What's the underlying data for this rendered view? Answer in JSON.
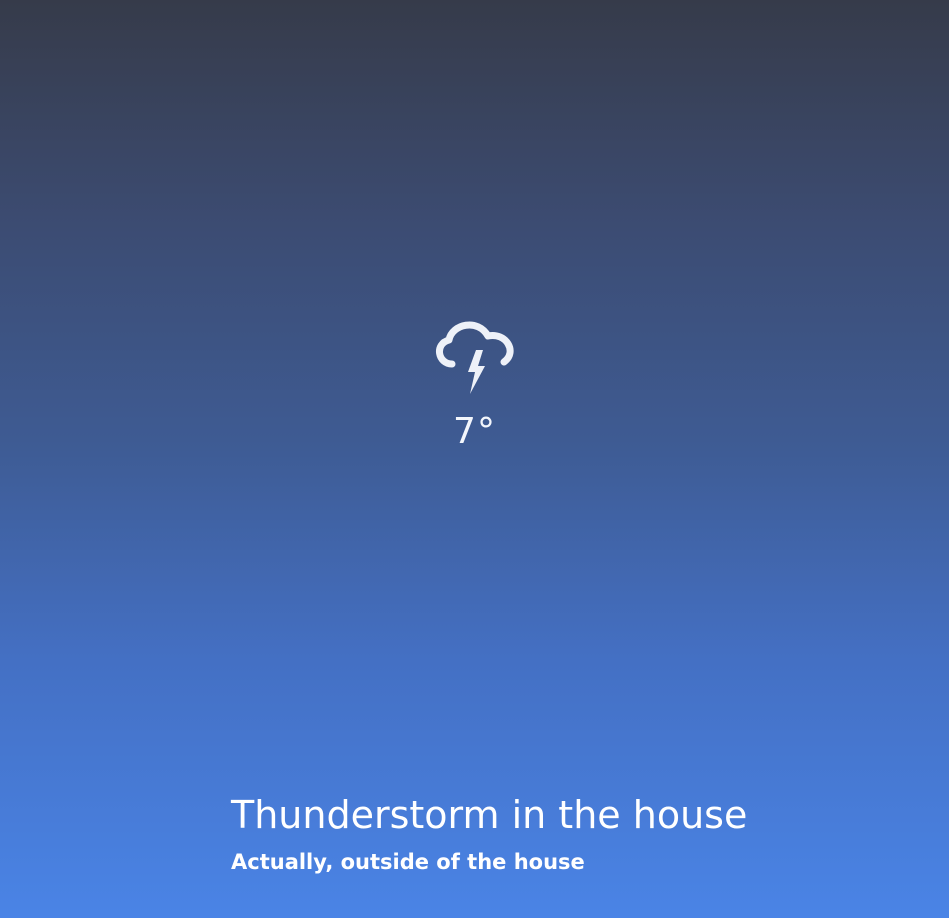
{
  "weather": {
    "condition_icon": "thunderstorm-icon",
    "temperature": "7°"
  },
  "caption": {
    "title": "Thunderstorm in the house",
    "subtitle": "Actually, outside of the house"
  },
  "colors": {
    "gradient_top": "#363b4a",
    "gradient_bottom": "#4a84e6",
    "text": "#ffffff"
  }
}
